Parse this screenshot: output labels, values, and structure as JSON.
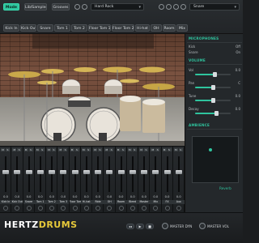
{
  "topbar": {
    "tabs": [
      "Mode",
      "Lib/Sampler",
      "Grooves"
    ],
    "kit_dropdown": "Hard Rock",
    "snare_dropdown": "Snare",
    "channel_tabs": [
      "Kick In",
      "Kick Out",
      "Snare",
      "Tom 1",
      "Tom 2",
      "Floor Tom 1",
      "Floor Tom 2",
      "Hi-hat",
      "OH",
      "Room",
      "Mix"
    ]
  },
  "panel": {
    "microphones_title": "MICROPHONES",
    "volume_title": "VOLUME",
    "ambience_title": "AMBIENCE",
    "microphone_rows": [
      {
        "label": "Kick",
        "value": "Off"
      },
      {
        "label": "Snare",
        "value": "On"
      }
    ],
    "volume_rows": [
      {
        "label": "Vol",
        "value": "0.0",
        "level": 0.55
      },
      {
        "label": "Pan",
        "value": "C",
        "level": 0.5
      },
      {
        "label": "Tune",
        "value": "0.0",
        "level": 0.5
      },
      {
        "label": "Decay",
        "value": "0.0",
        "level": 0.6
      }
    ],
    "ambience_link": "Reverb"
  },
  "mixer": {
    "strips": [
      {
        "name": "Kick In",
        "value": "0.0",
        "level": 0.55
      },
      {
        "name": "Kick Out",
        "value": "0.0",
        "level": 0.55
      },
      {
        "name": "Snare",
        "value": "0.0",
        "level": 0.55
      },
      {
        "name": "Tom 1",
        "value": "0.0",
        "level": 0.55
      },
      {
        "name": "Tom 2",
        "value": "0.0",
        "level": 0.55
      },
      {
        "name": "Tom 3",
        "value": "0.0",
        "level": 0.55
      },
      {
        "name": "Floor Tom",
        "value": "0.0",
        "level": 0.55
      },
      {
        "name": "Hi-hat",
        "value": "0.0",
        "level": 0.55
      },
      {
        "name": "Ride",
        "value": "0.0",
        "level": 0.55
      },
      {
        "name": "OH",
        "value": "0.0",
        "level": 0.55
      },
      {
        "name": "Room",
        "value": "0.0",
        "level": 0.55
      },
      {
        "name": "Bleed",
        "value": "0.0",
        "level": 0.55
      },
      {
        "name": "Master",
        "value": "0.0",
        "level": 0.55
      },
      {
        "name": "Mix",
        "value": "0.0",
        "level": 0.55
      },
      {
        "name": "FX",
        "value": "0.0",
        "level": 0.55
      },
      {
        "name": "Aux",
        "value": "0.0",
        "level": 0.55
      }
    ]
  },
  "footer": {
    "logo_main": "HERTZ",
    "logo_accent": "DRUMS",
    "master_dyn_label": "MASTER DYN",
    "master_vol_label": "MASTER VOL",
    "transport": [
      "",
      "",
      ""
    ]
  },
  "colors": {
    "accent": "#2fc49e",
    "logo_accent": "#e6c93a"
  }
}
